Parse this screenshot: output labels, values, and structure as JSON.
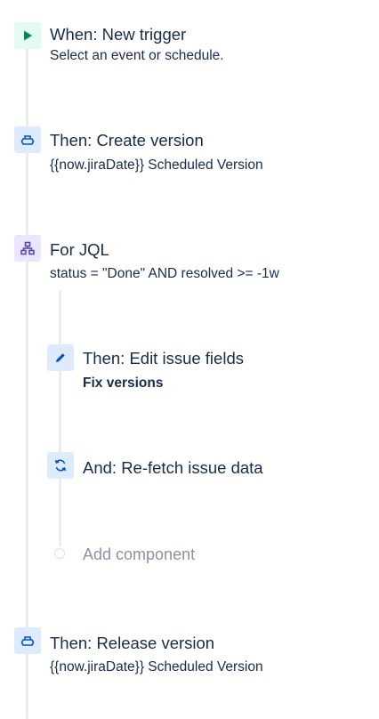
{
  "steps": [
    {
      "id": "trigger",
      "title": "When: New trigger",
      "subtitle": "Select an event or schedule.",
      "icon": "play-icon"
    },
    {
      "id": "create-version",
      "title": "Then: Create version",
      "subtitle": "{{now.jiraDate}} Scheduled Version",
      "icon": "version-icon"
    },
    {
      "id": "for-jql",
      "title": "For JQL",
      "subtitle": "status = \"Done\" AND resolved >= -1w",
      "icon": "branch-icon"
    },
    {
      "id": "edit-issue",
      "title": "Then: Edit issue fields",
      "subtitle": "Fix versions",
      "icon": "pencil-icon"
    },
    {
      "id": "refetch",
      "title": "And: Re-fetch issue data",
      "icon": "refresh-icon"
    },
    {
      "id": "release-version",
      "title": "Then: Release version",
      "subtitle": "{{now.jiraDate}} Scheduled Version",
      "icon": "version-icon"
    }
  ],
  "add_component": {
    "label": "Add component"
  },
  "colors": {
    "trigger_bg": "#e3fcef",
    "trigger_icon": "#00875a",
    "action_bg": "#deebff",
    "action_icon": "#0052cc",
    "branch_bg": "#eae6ff",
    "branch_icon": "#5243aa",
    "text": "#172b4d",
    "muted": "#8993a4",
    "rail": "#ebecf0"
  }
}
